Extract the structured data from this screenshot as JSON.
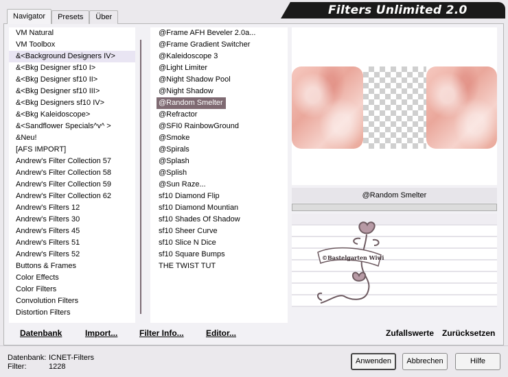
{
  "window": {
    "title": "Filters Unlimited 2.0"
  },
  "tabs": [
    {
      "label": "Navigator",
      "active": true
    },
    {
      "label": "Presets",
      "active": false
    },
    {
      "label": "Über",
      "active": false
    }
  ],
  "categories": [
    "VM Natural",
    "VM Toolbox",
    "&<Background Designers IV>",
    "&<Bkg Designer sf10 I>",
    "&<Bkg Designer sf10 II>",
    "&<Bkg Designer sf10 III>",
    "&<Bkg Designers sf10 IV>",
    "&<Bkg Kaleidoscope>",
    "&<Sandflower Specials^v^ >",
    "&Neu!",
    "[AFS IMPORT]",
    "Andrew's Filter Collection 57",
    "Andrew's Filter Collection 58",
    "Andrew's Filter Collection 59",
    "Andrew's Filter Collection 62",
    "Andrew's Filters 12",
    "Andrew's Filters 30",
    "Andrew's Filters 45",
    "Andrew's Filters 51",
    "Andrew's Filters 52",
    "Buttons & Frames",
    "Color Effects",
    "Color Filters",
    "Convolution Filters",
    "Distortion Filters"
  ],
  "filters": [
    "@Frame AFH Beveler 2.0a...",
    "@Frame Gradient Switcher",
    "@Kaleidoscope 3",
    "@Light Limiter",
    "@Night Shadow Pool",
    "@Night Shadow",
    "@Random Smelter",
    "@Refractor",
    "@SFI0 RainbowGround",
    "@Smoke",
    "@Spirals",
    "@Splash",
    "@Splish",
    "@Sun Raze...",
    "sf10 Diamond Flip",
    "sf10 Diamond Mountian",
    "sf10 Shades Of Shadow",
    "sf10 Sheer Curve",
    "sf10 Slice N Dice",
    "sf10 Square Bumps",
    "THE TWIST TUT"
  ],
  "selected_filter": "@Random Smelter",
  "preview": {
    "filter_name": "@Random Smelter",
    "watermark_text": "©Bastelgarten Wiwi"
  },
  "links": {
    "database": "Datenbank",
    "import": "Import...",
    "filter_info": "Filter Info...",
    "editor": "Editor...",
    "random": "Zufallswerte",
    "reset": "Zurücksetzen"
  },
  "status": {
    "database_label": "Datenbank:",
    "database_value": "ICNET-Filters",
    "filter_label": "Filter:",
    "filter_value": "1228"
  },
  "buttons": {
    "apply": "Anwenden",
    "cancel": "Abbrechen",
    "help": "Hilfe"
  },
  "colors": {
    "selection": "#7f6a72",
    "banner": "#1a1a1a",
    "preview_pink": "#f0b8ac"
  }
}
